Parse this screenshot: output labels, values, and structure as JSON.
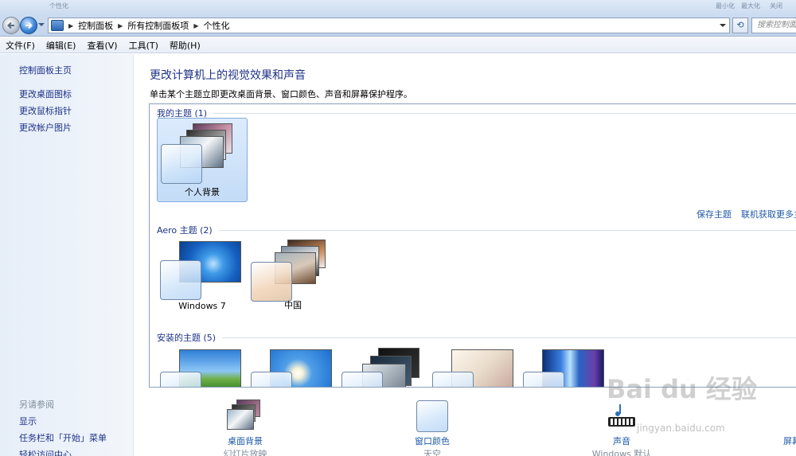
{
  "window": {
    "title": "个性化",
    "controls": [
      "最小化",
      "最大化",
      "关闭"
    ]
  },
  "address": {
    "crumbs": [
      "控制面板",
      "所有控制面板项",
      "个性化"
    ],
    "search_placeholder": "搜索控制面板"
  },
  "menu": [
    "文件(F)",
    "编辑(E)",
    "查看(V)",
    "工具(T)",
    "帮助(H)"
  ],
  "sidebar": {
    "home": "控制面板主页",
    "links": [
      "更改桌面图标",
      "更改鼠标指针",
      "更改帐户图片"
    ],
    "see_also": "另请参阅",
    "see_also_links": [
      "显示",
      "任务栏和「开始」菜单",
      "轻松访问中心"
    ]
  },
  "main": {
    "title": "更改计算机上的视觉效果和声音",
    "subtitle": "单击某个主题立即更改桌面背景、窗口颜色、声音和屏幕保护程序。",
    "groups": [
      {
        "heading": "我的主题 (1)",
        "themes": [
          "个人背景"
        ]
      },
      {
        "heading": "Aero 主题 (2)",
        "themes": [
          "Windows 7",
          "中国"
        ]
      },
      {
        "heading": "安装的主题 (5)",
        "themes": [
          "",
          "",
          "",
          "",
          ""
        ]
      }
    ],
    "save_theme": "保存主题",
    "get_more": "联机获取更多主题"
  },
  "bottom": [
    {
      "label": "桌面背景",
      "sub": "幻灯片放映"
    },
    {
      "label": "窗口颜色",
      "sub": "天空"
    },
    {
      "label": "声音",
      "sub": "Windows 默认"
    },
    {
      "label": "屏幕保护程序",
      "sub": ""
    }
  ],
  "watermark": {
    "text": "Bai du 经验",
    "url": "jingyan.baidu.com"
  },
  "colors": {
    "link": "#1e3287",
    "accent": "#1e5aa8",
    "selection": "#c4dcf7"
  }
}
